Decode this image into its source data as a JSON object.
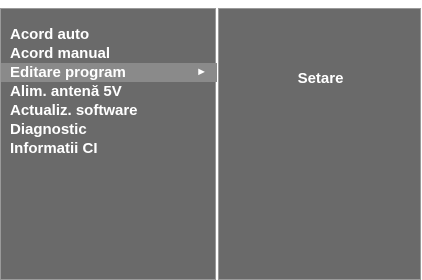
{
  "menu": {
    "items": [
      {
        "label": "Acord auto"
      },
      {
        "label": "Acord manual"
      },
      {
        "label": "Editare program",
        "selected": true
      },
      {
        "label": "Alim. antenă 5V"
      },
      {
        "label": "Actualiz. software"
      },
      {
        "label": "Diagnostic"
      },
      {
        "label": "Informatii CI"
      }
    ],
    "arrow": "►"
  },
  "submenu": {
    "title": "Setare"
  },
  "colors": {
    "panel": "#6a6a6a",
    "highlight": "#8a8a8a",
    "text": "#ffffff"
  },
  "icons": {
    "arrow": "submenu-arrow-icon"
  }
}
